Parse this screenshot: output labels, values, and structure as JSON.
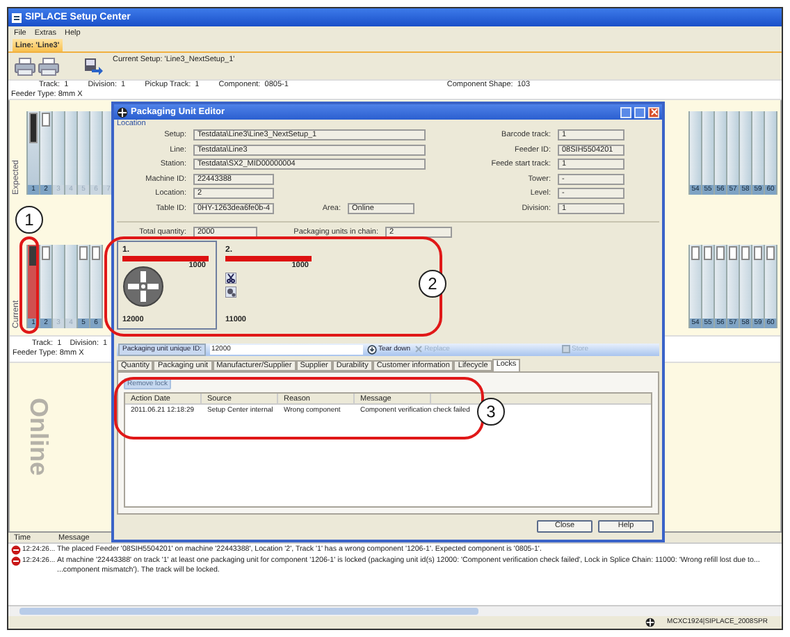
{
  "window": {
    "title": "SIPLACE Setup Center"
  },
  "menu": [
    "File",
    "Extras",
    "Help"
  ],
  "tabs": [
    {
      "label": "Line: 'Line3'",
      "selected": true
    }
  ],
  "current_setup": "Current Setup: 'Line3_NextSetup_1'",
  "info_top": [
    "Track:  1",
    "Division:  1",
    "Pickup Track:  1",
    "Component:  0805-1",
    "Component Shape:  103"
  ],
  "feeder_type_top": "Feeder Type: 8mm X",
  "rows": [
    {
      "label": "Expected",
      "left": [
        {
          "number": "1",
          "kind": "feeder",
          "selected": true
        },
        {
          "number": "2",
          "kind": "tray",
          "selected": true
        },
        {
          "number": "3",
          "kind": "empty",
          "selected": false
        },
        {
          "number": "4",
          "kind": "empty",
          "selected": false
        },
        {
          "number": "5",
          "kind": "empty",
          "selected": false
        },
        {
          "number": "6",
          "kind": "empty",
          "selected": false
        },
        {
          "number": "7",
          "kind": "empty",
          "selected": false
        }
      ],
      "right": [
        {
          "number": "54",
          "kind": "empty",
          "selected": true
        },
        {
          "number": "55",
          "kind": "empty",
          "selected": true
        },
        {
          "number": "56",
          "kind": "empty",
          "selected": true
        },
        {
          "number": "57",
          "kind": "empty",
          "selected": true
        },
        {
          "number": "58",
          "kind": "empty",
          "selected": true
        },
        {
          "number": "59",
          "kind": "empty",
          "selected": true
        },
        {
          "number": "60",
          "kind": "empty",
          "selected": true
        }
      ]
    },
    {
      "label": "Current",
      "left": [
        {
          "number": "1",
          "kind": "locked",
          "selected": true
        },
        {
          "number": "2",
          "kind": "tray",
          "selected": true
        },
        {
          "number": "3",
          "kind": "empty",
          "selected": false
        },
        {
          "number": "4",
          "kind": "empty",
          "selected": false
        },
        {
          "number": "5",
          "kind": "tray",
          "selected": true
        },
        {
          "number": "6",
          "kind": "tray",
          "selected": true
        }
      ],
      "right": [
        {
          "number": "54",
          "kind": "tray",
          "selected": true
        },
        {
          "number": "55",
          "kind": "tray",
          "selected": true
        },
        {
          "number": "56",
          "kind": "tray",
          "selected": true
        },
        {
          "number": "57",
          "kind": "tray",
          "selected": true
        },
        {
          "number": "58",
          "kind": "tray",
          "selected": true
        },
        {
          "number": "59",
          "kind": "tray",
          "selected": true
        },
        {
          "number": "60",
          "kind": "tray",
          "selected": true
        }
      ]
    }
  ],
  "info_bottom": [
    "Track:  1",
    "Division:  1"
  ],
  "feeder_type_bottom": "Feeder Type: 8mm X",
  "mode_label": "Online",
  "log": {
    "columns": [
      "Time",
      "Message"
    ],
    "rows": [
      {
        "time": "12:24:26...",
        "lines": [
          "The placed Feeder '08SIH5504201' on machine '22443388', Location '2', Track '1' has a wrong component '1206-1'. Expected component is '0805-1'."
        ]
      },
      {
        "time": "12:24:26...",
        "lines": [
          "At machine '22443388' on track '1' at least one packaging unit for component '1206-1' is locked (packaging unit id(s) 12000: 'Component verification check failed', Lock in Splice Chain: 11000: 'Wrong refill lost due to...",
          "...component mismatch'). The track will be locked."
        ]
      }
    ]
  },
  "status_bar": {
    "text": "MCXC1924|SIPLACE_2008SPR"
  },
  "dialog": {
    "title": "Packaging Unit Editor",
    "group": "Location",
    "left_fields": [
      {
        "label": "Setup:",
        "value": "Testdata\\Line3\\Line3_NextSetup_1",
        "kind": "wide"
      },
      {
        "label": "Line:",
        "value": "Testdata\\Line3",
        "kind": "wide"
      },
      {
        "label": "Station:",
        "value": "Testdata\\SX2_MID00000004",
        "kind": "wide"
      },
      {
        "label": "Machine ID:",
        "value": "22443388",
        "kind": "short"
      },
      {
        "label": "Location:",
        "value": "2",
        "kind": "short"
      },
      {
        "label": "Table ID:",
        "value": "0HY-1263dea6fe0b-4",
        "kind": "short"
      }
    ],
    "area": {
      "label": "Area:",
      "value": "Online"
    },
    "right_fields": [
      {
        "label": "Barcode track:",
        "value": "1"
      },
      {
        "label": "Feeder ID:",
        "value": "08SIH5504201"
      },
      {
        "label": "Feede start track:",
        "value": "1"
      },
      {
        "label": "Tower:",
        "value": "-"
      },
      {
        "label": "Level:",
        "value": "-"
      },
      {
        "label": "Division:",
        "value": "1"
      }
    ],
    "total_quantity": {
      "label": "Total quantity:",
      "value": "2000"
    },
    "units_in_chain": {
      "label": "Packaging units in chain:",
      "value": "2"
    },
    "units": [
      {
        "index": "1.",
        "quantity": "1000",
        "level": 1,
        "id": "12000",
        "kind": "reel",
        "selected": true
      },
      {
        "index": "2.",
        "quantity": "1000",
        "level": 1,
        "id": "11000",
        "kind": "tools",
        "selected": false
      }
    ],
    "unique_id": {
      "label": "Packaging unit unique ID:",
      "value": "12000"
    },
    "actions": [
      {
        "label": "Tear down",
        "kind": "teardown",
        "disabled": false
      },
      {
        "label": "Replace",
        "kind": "replace",
        "disabled": true
      },
      {
        "label": "Store",
        "kind": "store",
        "disabled": true
      }
    ],
    "tabs": [
      {
        "label": "Quantity",
        "selected": false
      },
      {
        "label": "Packaging unit",
        "selected": false
      },
      {
        "label": "Manufacturer/Supplier",
        "selected": false
      },
      {
        "label": "Supplier",
        "selected": false
      },
      {
        "label": "Durability",
        "selected": false
      },
      {
        "label": "Customer information",
        "selected": false
      },
      {
        "label": "Lifecycle",
        "selected": false
      },
      {
        "label": "Locks",
        "selected": true
      }
    ],
    "remove_lock": {
      "label": "Remove lock",
      "disabled": true
    },
    "locks_table": {
      "columns": [
        "Action Date",
        "Source",
        "Reason",
        "Message"
      ],
      "rows": [
        [
          "2011.06.21 12:18:29",
          "Setup Center internal",
          "Wrong component",
          "Component verification check failed"
        ]
      ]
    },
    "buttons": [
      "Close",
      "Help"
    ]
  },
  "annotations": [
    "1",
    "2",
    "3"
  ]
}
